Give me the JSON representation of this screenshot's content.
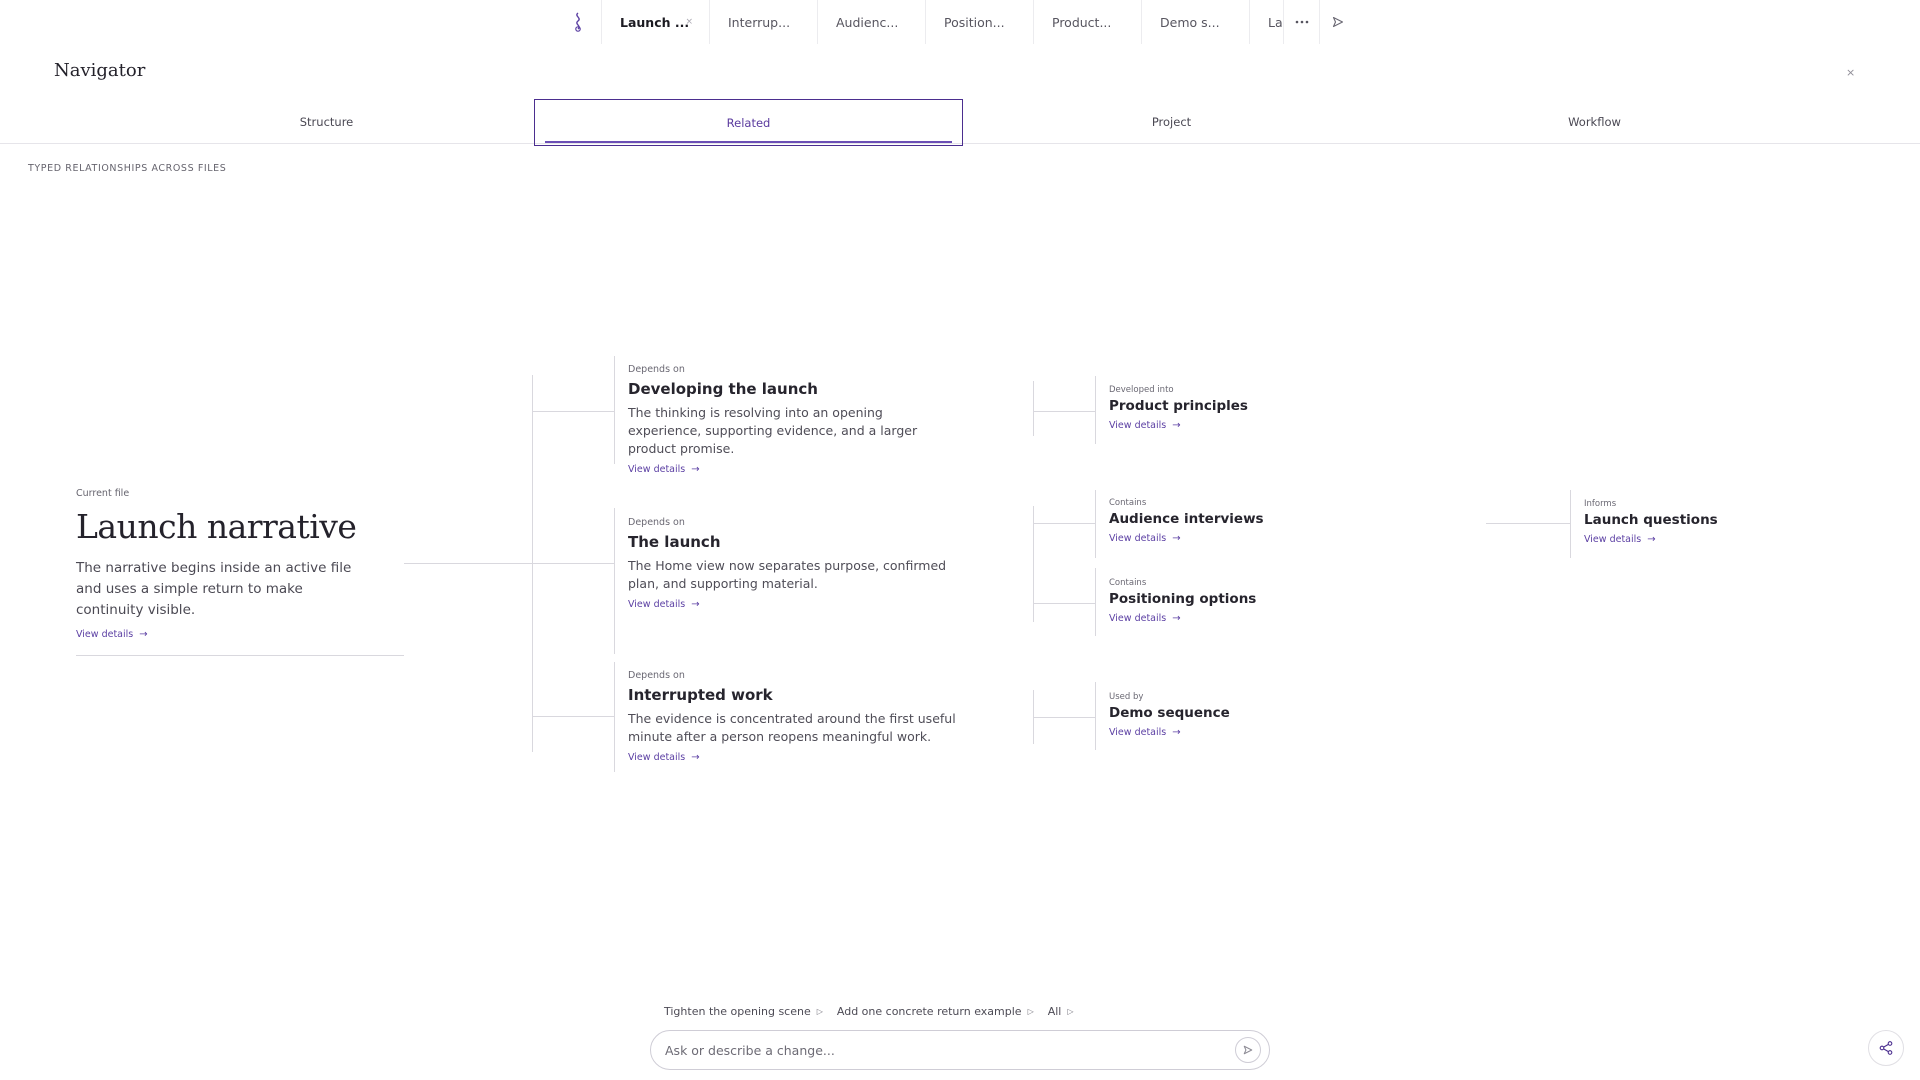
{
  "tabs": [
    {
      "label": "Launch ...",
      "active": true,
      "close": "×"
    },
    {
      "label": "Interrup..."
    },
    {
      "label": "Audienc..."
    },
    {
      "label": "Position..."
    },
    {
      "label": "Product..."
    },
    {
      "label": "Demo s..."
    },
    {
      "label": "La"
    }
  ],
  "tab_overflow_icon": "ellipsis-icon",
  "tab_send_icon": "send-icon",
  "panel": {
    "title": "Navigator",
    "close": "×"
  },
  "subtabs": [
    {
      "label": "Structure"
    },
    {
      "label": "Related",
      "active": true
    },
    {
      "label": "Project"
    },
    {
      "label": "Workflow"
    }
  ],
  "section_label": "TYPED RELATIONSHIPS ACROSS FILES",
  "current": {
    "rel": "Current file",
    "title": "Launch narrative",
    "desc": "The narrative begins inside an active file and uses a simple return to make continuity visible.",
    "link": "View details"
  },
  "level1": [
    {
      "rel": "Depends on",
      "title": "Developing the launch",
      "desc": "The thinking is resolving into an opening experience, supporting evidence, and a larger product promise.",
      "link": "View details"
    },
    {
      "rel": "Depends on",
      "title": "The launch",
      "desc": "The Home view now separates purpose, confirmed plan, and supporting material.",
      "link": "View details"
    },
    {
      "rel": "Depends on",
      "title": "Interrupted work",
      "desc": "The evidence is concentrated around the first useful minute after a person reopens meaningful work.",
      "link": "View details"
    }
  ],
  "level2": [
    {
      "rel": "Developed into",
      "title": "Product principles",
      "link": "View details"
    },
    {
      "rel": "Contains",
      "title": "Audience interviews",
      "link": "View details"
    },
    {
      "rel": "Contains",
      "title": "Positioning options",
      "link": "View details"
    },
    {
      "rel": "Used by",
      "title": "Demo sequence",
      "link": "View details"
    }
  ],
  "level3": [
    {
      "rel": "Informs",
      "title": "Launch questions",
      "link": "View details"
    }
  ],
  "arrow": "→",
  "suggestions": [
    {
      "label": "Tighten the opening scene"
    },
    {
      "label": "Add one concrete return example"
    },
    {
      "label": "All"
    }
  ],
  "composer": {
    "placeholder": "Ask or describe a change..."
  },
  "colors": {
    "accent": "#5b3fa3",
    "border": "#4b2e8f",
    "rule": "#d9d8de"
  }
}
